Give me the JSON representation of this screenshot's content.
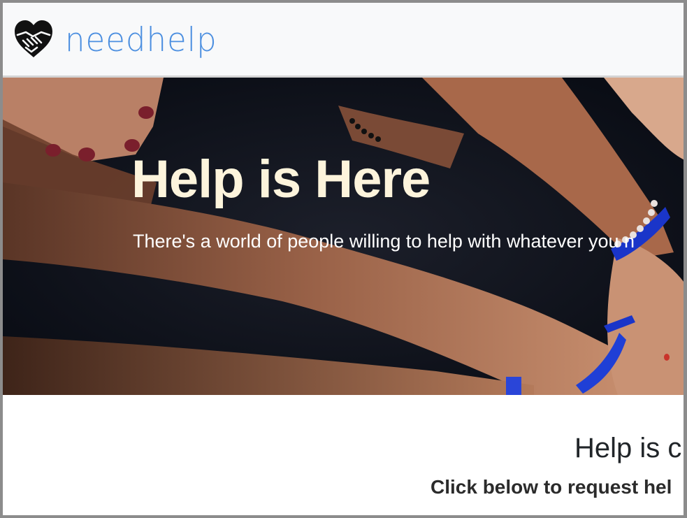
{
  "navbar": {
    "brand_name": "needhelp",
    "logo_icon": "heart-handshake-icon",
    "brand_color": "#4c8fe0"
  },
  "hero": {
    "title": "Help is Here",
    "subtitle": "There's a world of people willing to help with whatever you n",
    "title_color": "#fdf4dc"
  },
  "content": {
    "title": "Help is c",
    "subtitle": "Click below to request hel"
  }
}
